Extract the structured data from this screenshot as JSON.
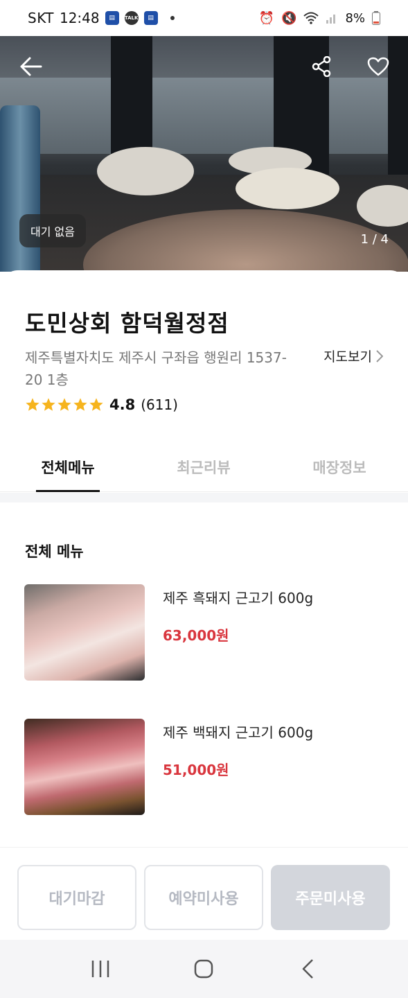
{
  "status_bar": {
    "carrier": "SKT",
    "time": "12:48",
    "battery": "8%"
  },
  "hero": {
    "waiting_badge": "대기 없음",
    "page_indicator": "1 / 4"
  },
  "store": {
    "name": "도민상회 함덕월정점",
    "address": "제주특별자치도 제주시 구좌읍 행원리 1537-20 1층",
    "map_link": "지도보기",
    "rating": "4.8",
    "review_count": "(611)",
    "stars": 5
  },
  "tabs": [
    {
      "label": "전체메뉴",
      "active": true
    },
    {
      "label": "최근리뷰",
      "active": false
    },
    {
      "label": "매장정보",
      "active": false
    }
  ],
  "menu": {
    "title": "전체 메뉴",
    "items": [
      {
        "name": "제주 흑돼지 근고기 600g",
        "price": "63,000원"
      },
      {
        "name": "제주 백돼지 근고기 600g",
        "price": "51,000원"
      }
    ]
  },
  "actions": {
    "waiting": "대기마감",
    "reservation": "예약미사용",
    "order": "주문미사용"
  },
  "colors": {
    "price": "#d9363e",
    "star": "#f6b41e",
    "disabled_button": "#d3d6dc"
  }
}
